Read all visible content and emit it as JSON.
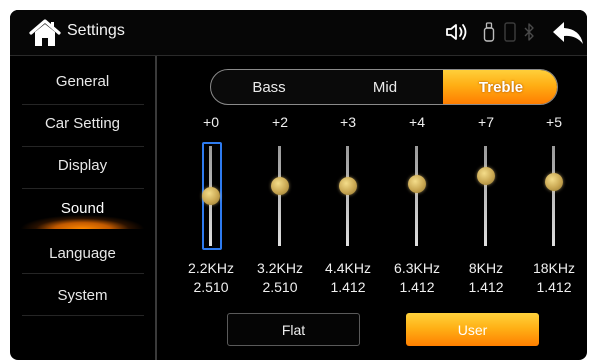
{
  "header": {
    "title": "Settings",
    "icons": [
      "home-icon",
      "volume-icon",
      "usb-icon",
      "phone-icon",
      "bluetooth-icon",
      "back-arrow-icon"
    ]
  },
  "sidebar": {
    "items": [
      {
        "label": "General",
        "active": false
      },
      {
        "label": "Car Setting",
        "active": false
      },
      {
        "label": "Display",
        "active": false
      },
      {
        "label": "Sound",
        "active": true
      },
      {
        "label": "Language",
        "active": false
      },
      {
        "label": "System",
        "active": false
      }
    ]
  },
  "tabs": [
    {
      "label": "Bass",
      "active": false
    },
    {
      "label": "Mid",
      "active": false
    },
    {
      "label": "Treble",
      "active": true
    }
  ],
  "equalizer": {
    "bands": [
      {
        "gain": "+0",
        "freq": "2.2KHz",
        "value": "2.510",
        "level": 0.5,
        "focused": true
      },
      {
        "gain": "+2",
        "freq": "3.2KHz",
        "value": "2.510",
        "level": 0.6,
        "focused": false
      },
      {
        "gain": "+3",
        "freq": "4.4KHz",
        "value": "1.412",
        "level": 0.6,
        "focused": false
      },
      {
        "gain": "+4",
        "freq": "6.3KHz",
        "value": "1.412",
        "level": 0.62,
        "focused": false
      },
      {
        "gain": "+7",
        "freq": "8KHz",
        "value": "1.412",
        "level": 0.7,
        "focused": false
      },
      {
        "gain": "+5",
        "freq": "18KHz",
        "value": "1.412",
        "level": 0.64,
        "focused": false
      }
    ]
  },
  "buttons": {
    "flat_label": "Flat",
    "user_label": "User"
  },
  "colors": {
    "accent": "#ffa500",
    "focus": "#2e7bf0",
    "background": "#000000"
  }
}
